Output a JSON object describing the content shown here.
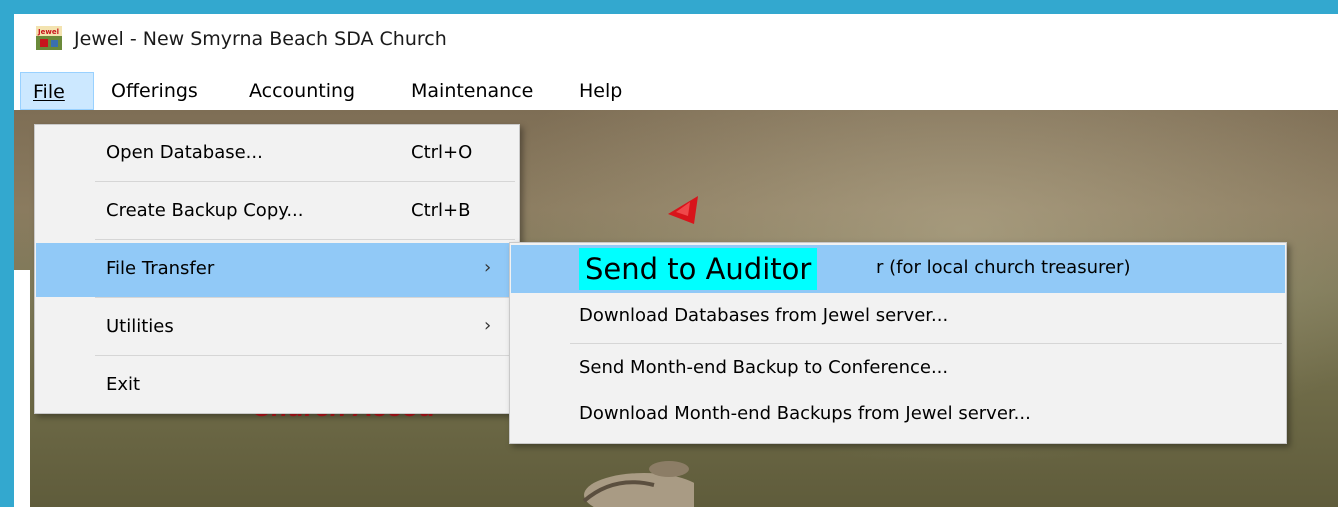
{
  "window": {
    "title": "Jewel - New Smyrna Beach SDA Church"
  },
  "icons": {
    "app": "jewel-app-icon",
    "submenu_arrow": "chevron-right-icon"
  },
  "menubar": {
    "items": [
      {
        "label": "File",
        "active": true
      },
      {
        "label": "Offerings"
      },
      {
        "label": "Accounting"
      },
      {
        "label": "Maintenance"
      },
      {
        "label": "Help"
      }
    ]
  },
  "file_menu": {
    "items": [
      {
        "label": "Open Database...",
        "shortcut": "Ctrl+O"
      },
      {
        "label": "Create Backup Copy...",
        "shortcut": "Ctrl+B"
      },
      {
        "label": "File Transfer",
        "submenu": true,
        "highlighted": true
      },
      {
        "label": "Utilities",
        "submenu": true
      },
      {
        "label": "Exit"
      }
    ]
  },
  "file_transfer_menu": {
    "items": [
      {
        "label": "Send to Auditor (for local church treasurer)",
        "visible_suffix": "r (for local church treasurer)",
        "highlighted": true
      },
      {
        "label": "Download Databases from Jewel server..."
      },
      {
        "label": "Send Month-end Backup to Conference..."
      },
      {
        "label": "Download Month-end Backups from Jewel server..."
      }
    ]
  },
  "callout": {
    "text": "Send to Auditor",
    "color": "#00ffff"
  },
  "background": {
    "brand_text": "Church Accou"
  },
  "colors": {
    "highlight": "#91c9f7",
    "menu_bg": "#f2f2f2",
    "frame": "#33a8cf",
    "brand_red": "#c8151d"
  }
}
